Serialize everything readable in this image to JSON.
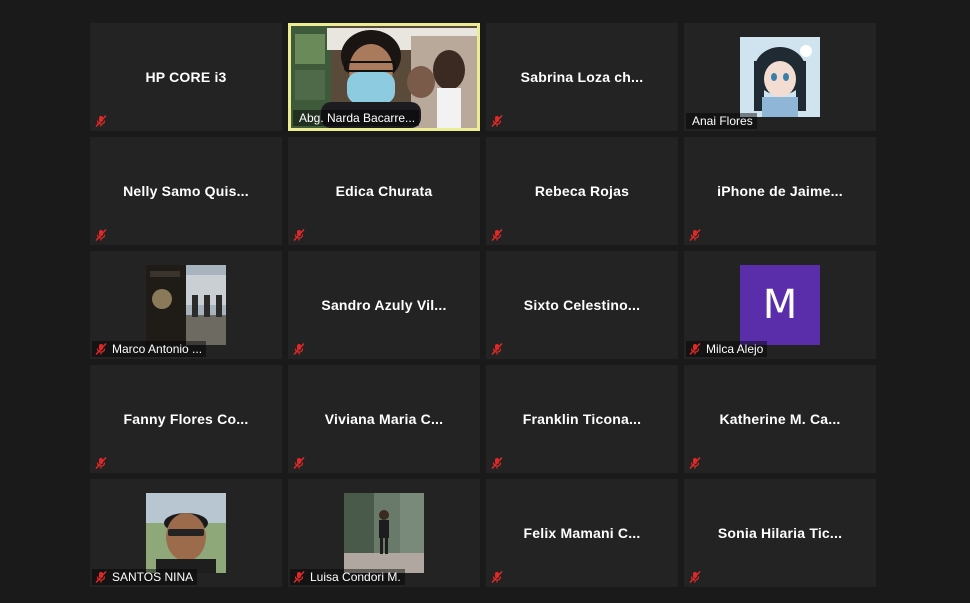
{
  "tiles": [
    {
      "label": "HP CORE i3"
    },
    {
      "label": "Abg. Narda Bacarre..."
    },
    {
      "label": "Sabrina  Loza  ch..."
    },
    {
      "label": "Anai Flores"
    },
    {
      "label": "Nelly  Samo  Quis..."
    },
    {
      "label": "Edica Churata"
    },
    {
      "label": "Rebeca Rojas"
    },
    {
      "label": "iPhone  de  Jaime..."
    },
    {
      "label": "Marco Antonio ..."
    },
    {
      "label": "Sandro  Azuly  Vil..."
    },
    {
      "label": "Sixto  Celestino..."
    },
    {
      "label": "Milca Alejo",
      "avatar_letter": "M"
    },
    {
      "label": "Fanny  Flores  Co..."
    },
    {
      "label": "Viviana  Maria  C..."
    },
    {
      "label": "Franklin  Ticona..."
    },
    {
      "label": "Katherine  M.  Ca..."
    },
    {
      "label": "SANTOS NINA"
    },
    {
      "label": "Luisa Condori M."
    },
    {
      "label": "Felix  Mamani  C..."
    },
    {
      "label": "Sonia  Hilaria  Tic..."
    }
  ],
  "colors": {
    "background": "#1a1a1a",
    "tile": "#232323",
    "active_border": "#ecec93",
    "mute_red": "#e02828",
    "avatar_purple": "#5a2eab"
  },
  "icons": {
    "mute": "microphone-muted-icon"
  }
}
